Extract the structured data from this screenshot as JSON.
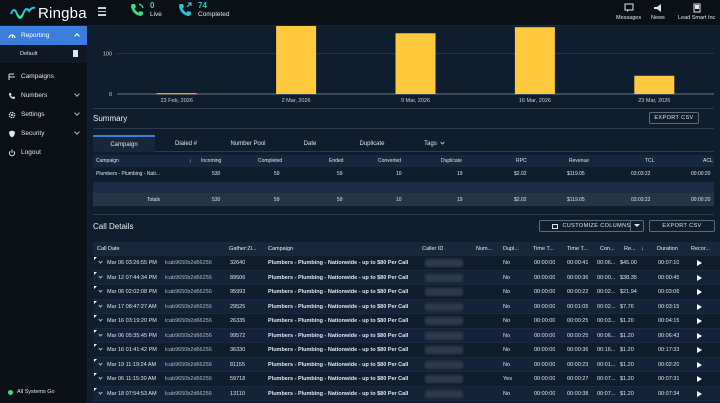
{
  "app": {
    "name": "Ringba"
  },
  "topbar": {
    "live": {
      "count": "0",
      "label": "Live"
    },
    "completed": {
      "count": "74",
      "label": "Completed"
    },
    "messages_label": "Messages",
    "news_label": "News",
    "account_label": "Lead Smart Inc"
  },
  "sidebar": {
    "items": [
      {
        "label": "Reporting",
        "icon": "gauge-icon"
      },
      {
        "label": "Default",
        "icon": "document-icon"
      },
      {
        "label": "Campaigns",
        "icon": "route-icon"
      },
      {
        "label": "Numbers",
        "icon": "phone-icon"
      },
      {
        "label": "Settings",
        "icon": "gear-icon"
      },
      {
        "label": "Security",
        "icon": "shield-icon"
      },
      {
        "label": "Logout",
        "icon": "power-icon"
      }
    ],
    "status": "All Systems Go"
  },
  "chart_data": {
    "type": "bar",
    "categories": [
      "23 Feb, 2026",
      "2 Mar, 2026",
      "9 Mar, 2026",
      "16 Mar, 2026",
      "23 Mar, 2026"
    ],
    "values": [
      2,
      170,
      150,
      165,
      45
    ],
    "yticks": [
      "100",
      "0"
    ],
    "ylim": [
      0,
      200
    ],
    "bar_color": "#ffc83d"
  },
  "summary": {
    "title": "Summary",
    "export_label": "EXPORT CSV",
    "tabs": [
      "Campaign",
      "Dialed #",
      "Number Pool",
      "Date",
      "Duplicate",
      "Tags"
    ],
    "columns": [
      "Campaign",
      "Incoming",
      "Completed",
      "Ended",
      "Converted",
      "Duplicate",
      "RPC",
      "Revenue",
      "TCL",
      "ACL"
    ],
    "row": [
      "Plumbers - Plumbing - Nati...",
      "530",
      "59",
      "59",
      "10",
      "19",
      "$2.02",
      "$119.05",
      "03:03:22",
      "00:00:20"
    ],
    "total": [
      "Totals",
      "530",
      "59",
      "59",
      "10",
      "19",
      "$2.02",
      "$119.05",
      "03:03:22",
      "00:00:20"
    ]
  },
  "calls": {
    "title": "Call Details",
    "customize_label": "CUSTOMIZE COLUMNS",
    "export_label": "EXPORT CSV",
    "columns": [
      "Call Date",
      "Gather:Zi...",
      "Campaign",
      "Caller ID",
      "Num...",
      "Dupl...",
      "Time T...",
      "Time T...",
      "Con...",
      "Re...",
      "Duration",
      "Recor..."
    ],
    "rows": [
      {
        "date": "Mar 06 03:26:55 PM",
        "id": "lcab9650b2d66256",
        "zip": "32640",
        "campaign": "Plumbers - Plumbing - Nationwide - up to $80 Per Call",
        "dup": "No",
        "tt1": "00:00:00",
        "tt2": "00:00:41",
        "con": "00:06...",
        "rev": "$45.00",
        "dur": "00:07:10"
      },
      {
        "date": "Mar 12 07:44:34 PM",
        "id": "lcab9650b2d66256",
        "zip": "89506",
        "campaign": "Plumbers - Plumbing - Nationwide - up to $80 Per Call",
        "dup": "No",
        "tt1": "00:00:00",
        "tt2": "00:00:36",
        "con": "00:00...",
        "rev": "$38.35",
        "dur": "00:00:45"
      },
      {
        "date": "Mar 06 02:02:08 PM",
        "id": "lcab9650b2d66256",
        "zip": "95993",
        "campaign": "Plumbers - Plumbing - Nationwide - up to $80 Per Call",
        "dup": "No",
        "tt1": "00:00:00",
        "tt2": "00:00:22",
        "con": "00:02...",
        "rev": "$21.94",
        "dur": "00:03:06"
      },
      {
        "date": "Mar 17 08:47:27 AM",
        "id": "lcab9650b2d66256",
        "zip": "29525",
        "campaign": "Plumbers - Plumbing - Nationwide - up to $80 Per Call",
        "dup": "No",
        "tt1": "00:00:00",
        "tt2": "00:01:05",
        "con": "00:02...",
        "rev": "$7.76",
        "dur": "00:03:15"
      },
      {
        "date": "Mar 16 03:19:20 PM",
        "id": "lcab9650b2d66256",
        "zip": "26335",
        "campaign": "Plumbers - Plumbing - Nationwide - up to $80 Per Call",
        "dup": "No",
        "tt1": "00:00:00",
        "tt2": "00:00:25",
        "con": "00:03...",
        "rev": "$1.20",
        "dur": "00:04:15"
      },
      {
        "date": "Mar 06 05:35:45 PM",
        "id": "lcab9650b2d66256",
        "zip": "99572",
        "campaign": "Plumbers - Plumbing - Nationwide - up to $80 Per Call",
        "dup": "No",
        "tt1": "00:00:00",
        "tt2": "00:00:25",
        "con": "00:06...",
        "rev": "$1.20",
        "dur": "00:06:43"
      },
      {
        "date": "Mar 16 01:41:42 PM",
        "id": "lcab9650b2d66256",
        "zip": "36330",
        "campaign": "Plumbers - Plumbing - Nationwide - up to $80 Per Call",
        "dup": "No",
        "tt1": "00:00:00",
        "tt2": "00:00:36",
        "con": "00:16...",
        "rev": "$1.20",
        "dur": "00:17:33"
      },
      {
        "date": "Mar 19 11:19:24 AM",
        "id": "lcab9650b2d66256",
        "zip": "81155",
        "campaign": "Plumbers - Plumbing - Nationwide - up to $80 Per Call",
        "dup": "No",
        "tt1": "00:00:00",
        "tt2": "00:00:23",
        "con": "00:01...",
        "rev": "$1.20",
        "dur": "00:02:20"
      },
      {
        "date": "Mar 06 11:15:30 AM",
        "id": "lcab9650b2d66256",
        "zip": "59718",
        "campaign": "Plumbers - Plumbing - Nationwide - up to $80 Per Call",
        "dup": "Yes",
        "tt1": "00:00:00",
        "tt2": "00:00:27",
        "con": "00:07...",
        "rev": "$1.20",
        "dur": "00:07:31"
      },
      {
        "date": "Mar 18 07:54:53 AM",
        "id": "lcab9650b2d66256",
        "zip": "13110",
        "campaign": "Plumbers - Plumbing - Nationwide - up to $80 Per Call",
        "dup": "No",
        "tt1": "00:00:00",
        "tt2": "00:00:38",
        "con": "00:07...",
        "rev": "$1.20",
        "dur": "00:07:34"
      }
    ]
  }
}
